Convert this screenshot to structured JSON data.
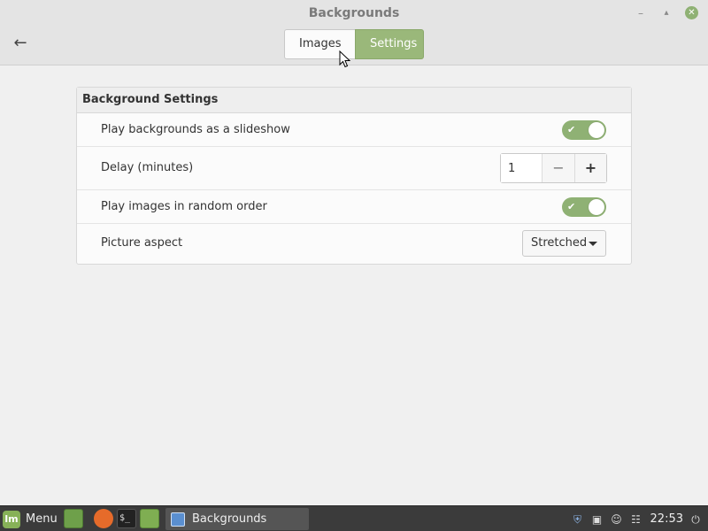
{
  "window": {
    "title": "Backgrounds",
    "back_icon": "arrow-left-icon",
    "controls": {
      "minimize": "minimize-icon",
      "maximize": "maximize-icon",
      "close": "close-icon"
    }
  },
  "tabs": [
    {
      "label": "Images",
      "active": false
    },
    {
      "label": "Settings",
      "active": true
    }
  ],
  "settings": {
    "header": "Background Settings",
    "slideshow": {
      "label": "Play backgrounds as a slideshow",
      "enabled": true
    },
    "delay": {
      "label": "Delay (minutes)",
      "value": "1",
      "minus": "−",
      "plus": "+"
    },
    "random": {
      "label": "Play images in random order",
      "enabled": true
    },
    "aspect": {
      "label": "Picture aspect",
      "value": "Stretched"
    }
  },
  "colors": {
    "accent": "#9ab87a",
    "switch_on": "#8fb174",
    "taskbar": "#3b3b3b"
  },
  "taskbar": {
    "menu_label": "Menu",
    "launchers": [
      "show-desktop-icon",
      "firefox-icon",
      "terminal-icon",
      "files-icon"
    ],
    "task_label": "Backgrounds",
    "tray_icons": [
      "shield-icon",
      "clipboard-icon",
      "user-icon",
      "network-icon",
      "power-icon"
    ],
    "clock": "22:53"
  }
}
